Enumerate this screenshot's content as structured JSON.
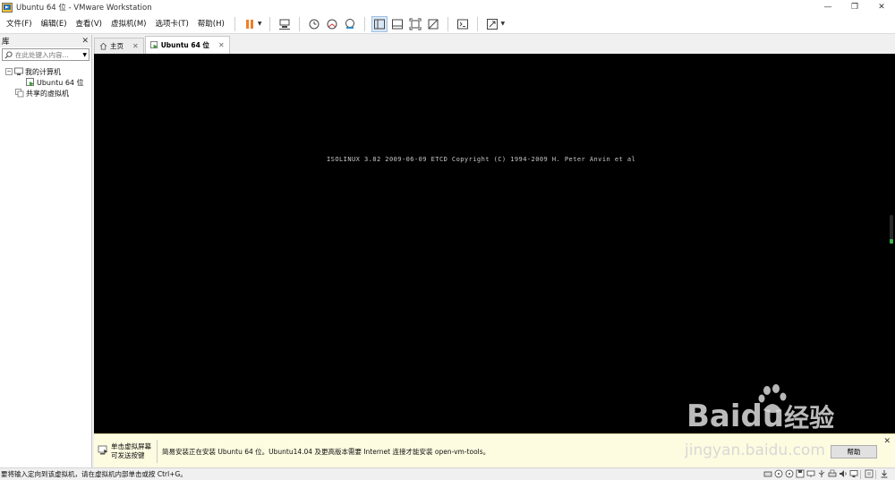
{
  "window": {
    "title": "Ubuntu 64 位 - VMware Workstation",
    "controls": [
      "—",
      "❐",
      "✕"
    ]
  },
  "menu": [
    "文件(F)",
    "编辑(E)",
    "查看(V)",
    "虚拟机(M)",
    "选项卡(T)",
    "帮助(H)"
  ],
  "colors": {
    "pause_accent": "#f07e26",
    "console_bg": "#000000",
    "hint_bg": "#fdfbe0"
  },
  "library": {
    "title": "库",
    "close": "✕",
    "search_placeholder": "在此处键入内容...",
    "tree": {
      "root": "我的计算机",
      "vm": "Ubuntu 64 位",
      "shared": "共享的虚拟机"
    }
  },
  "tabs": [
    {
      "label": "主页",
      "icon": "home-icon",
      "close": "✕"
    },
    {
      "label": "Ubuntu 64 位",
      "icon": "vm-icon",
      "close": "✕",
      "active": true
    }
  ],
  "console": {
    "boot_text": "ISOLINUX 3.82 2009-06-09 ETCD Copyright (C) 1994-2009 H. Peter Anvin et al"
  },
  "hint": {
    "left_line1": "单击虚拟屏幕",
    "left_line2": "可发送按键",
    "message": "简易安装正在安装 Ubuntu 64 位。Ubuntu14.04 及更高版本需要 Internet 连接才能安装 open-vm-tools。",
    "help_button": "帮助",
    "close": "✕"
  },
  "status": {
    "text": "要将输入定向到该虚拟机，请在虚拟机内部单击或按 Ctrl+G。"
  },
  "watermark": {
    "brand": "Baidu经验",
    "url": "jingyan.baidu.com"
  }
}
